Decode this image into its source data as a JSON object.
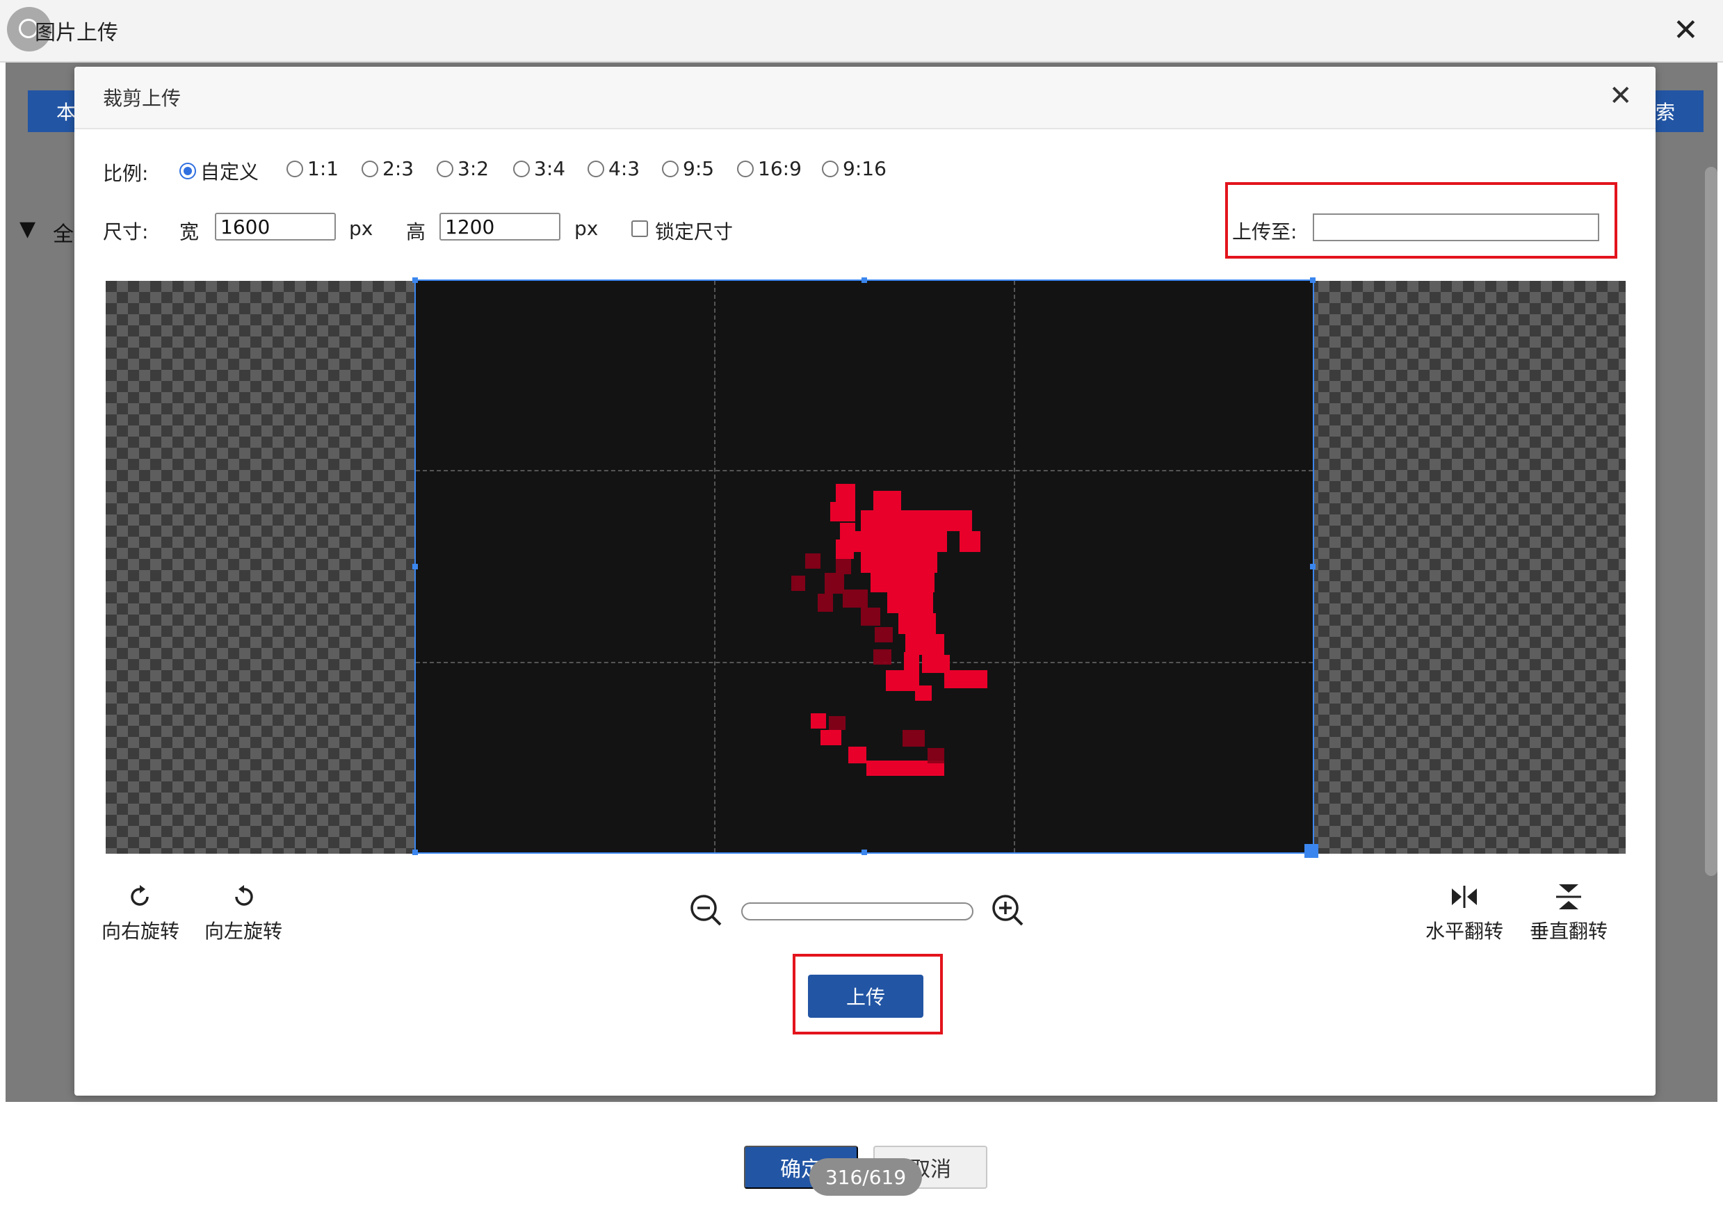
{
  "outer_window": {
    "title": "图片上传",
    "bg_button_left": "本",
    "bg_button_right": "索",
    "tree_arrow": "▼",
    "tree_label": "全",
    "ok_label": "确定",
    "cancel_label": "取消",
    "page_counter": "316/619"
  },
  "dialog": {
    "title": "裁剪上传",
    "ratio_label": "比例:",
    "ratio_options": [
      "自定义",
      "1:1",
      "2:3",
      "3:2",
      "3:4",
      "4:3",
      "9:5",
      "16:9",
      "9:16"
    ],
    "ratio_selected": "自定义",
    "size_label": "尺寸:",
    "width_label": "宽",
    "width_value": "1600",
    "width_unit": "px",
    "height_label": "高",
    "height_value": "1200",
    "height_unit": "px",
    "lock_label": "锁定尺寸",
    "lock_checked": false,
    "upload_to_label": "上传至:",
    "upload_to_value": "",
    "tools": {
      "rotate_right": "向右旋转",
      "rotate_left": "向左旋转",
      "flip_horizontal": "水平翻转",
      "flip_vertical": "垂直翻转"
    },
    "upload_button": "上传"
  },
  "colors": {
    "primary": "#2255a4",
    "highlight": "#e3141d",
    "crop_border": "#3b86ee",
    "logo_red": "#e8002a"
  }
}
